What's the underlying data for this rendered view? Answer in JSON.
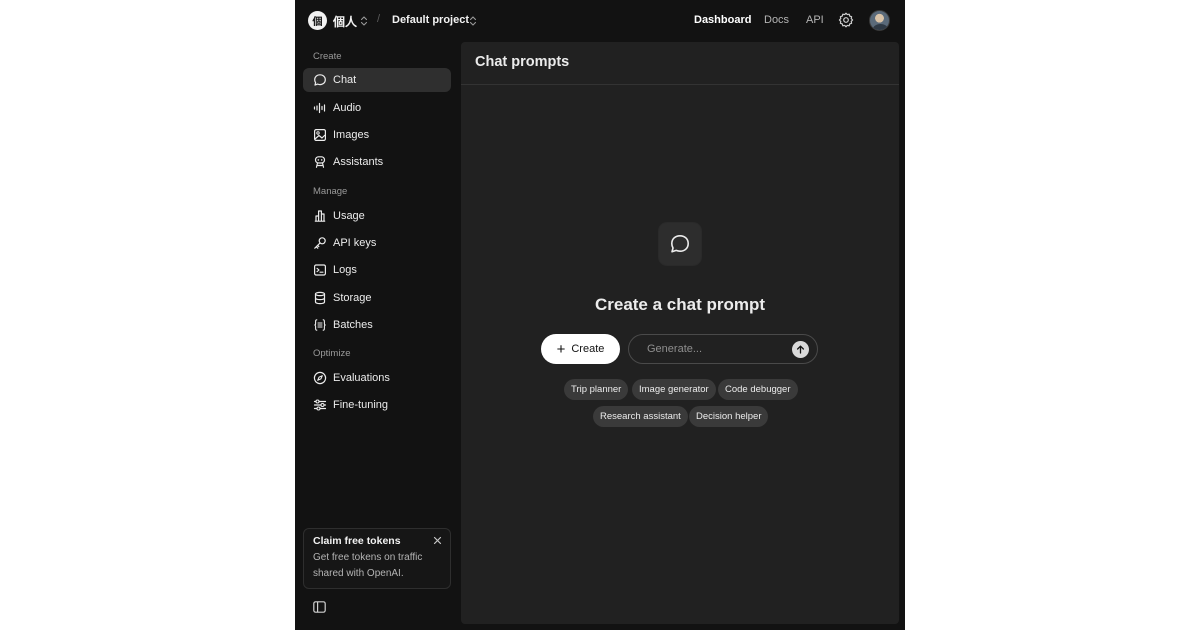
{
  "topbar": {
    "org_badge": "個",
    "org_name": "個人",
    "project_name": "Default project",
    "nav": [
      {
        "label": "Dashboard",
        "active": true
      },
      {
        "label": "Docs",
        "active": false
      },
      {
        "label": "API",
        "active": false
      }
    ],
    "icons": {
      "settings": "gear-icon",
      "avatar": "user-avatar"
    }
  },
  "sidebar": {
    "sections": [
      {
        "label": "Create",
        "items": [
          {
            "label": "Chat",
            "icon": "chat-bubble-icon",
            "active": true
          },
          {
            "label": "Audio",
            "icon": "audio-waveform-icon",
            "active": false
          },
          {
            "label": "Images",
            "icon": "image-icon",
            "active": false
          },
          {
            "label": "Assistants",
            "icon": "robot-icon",
            "active": false
          }
        ]
      },
      {
        "label": "Manage",
        "items": [
          {
            "label": "Usage",
            "icon": "bar-chart-icon",
            "active": false
          },
          {
            "label": "API keys",
            "icon": "key-icon",
            "active": false
          },
          {
            "label": "Logs",
            "icon": "terminal-icon",
            "active": false
          },
          {
            "label": "Storage",
            "icon": "database-icon",
            "active": false
          },
          {
            "label": "Batches",
            "icon": "batch-braces-icon",
            "active": false
          }
        ]
      },
      {
        "label": "Optimize",
        "items": [
          {
            "label": "Evaluations",
            "icon": "compass-icon",
            "active": false
          },
          {
            "label": "Fine-tuning",
            "icon": "sliders-icon",
            "active": false
          }
        ]
      }
    ],
    "promo": {
      "title": "Claim free tokens",
      "text": "Get free tokens on traffic shared with OpenAI."
    }
  },
  "main": {
    "title": "Chat prompts",
    "empty_state": {
      "title": "Create a chat prompt",
      "create_label": "Create",
      "generate_placeholder": "Generate...",
      "suggestions": [
        "Trip planner",
        "Image generator",
        "Code debugger",
        "Research assistant",
        "Decision helper"
      ]
    }
  },
  "colors": {
    "app_background": "#121212",
    "panel_background": "#212121",
    "active_item": "#2f2f2f",
    "chip_background": "#3a3a3a",
    "primary_button": "#ffffff"
  }
}
